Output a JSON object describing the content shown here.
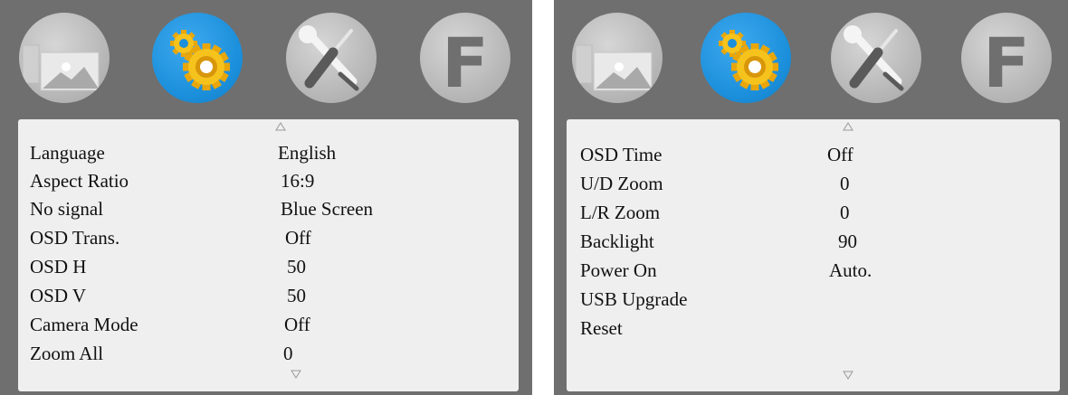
{
  "panels": [
    {
      "rows": [
        {
          "label": "Language",
          "value": "English"
        },
        {
          "label": "Aspect Ratio",
          "value": "16:9"
        },
        {
          "label": "No signal",
          "value": "Blue Screen"
        },
        {
          "label": "OSD Trans.",
          "value": "Off"
        },
        {
          "label": "OSD H",
          "value": "50"
        },
        {
          "label": "OSD V",
          "value": "50"
        },
        {
          "label": "Camera Mode",
          "value": "Off"
        },
        {
          "label": "Zoom All",
          "value": "0"
        }
      ]
    },
    {
      "rows": [
        {
          "label": "OSD Time",
          "value": "Off"
        },
        {
          "label": "U/D Zoom",
          "value": "0"
        },
        {
          "label": "L/R Zoom",
          "value": "0"
        },
        {
          "label": "Backlight",
          "value": "90"
        },
        {
          "label": "Power On",
          "value": "Auto."
        },
        {
          "label": "USB Upgrade",
          "value": ""
        },
        {
          "label": "Reset",
          "value": ""
        }
      ]
    }
  ],
  "tab_letter": "F",
  "colors": {
    "frame": "#6f6f6f",
    "menu_bg": "#efefef",
    "active_tab": "#1b8fdb",
    "inactive_tab": "#b4b4b4"
  },
  "icons": [
    "picture-icon",
    "settings-gears-icon",
    "tools-icon",
    "factory-icon"
  ]
}
